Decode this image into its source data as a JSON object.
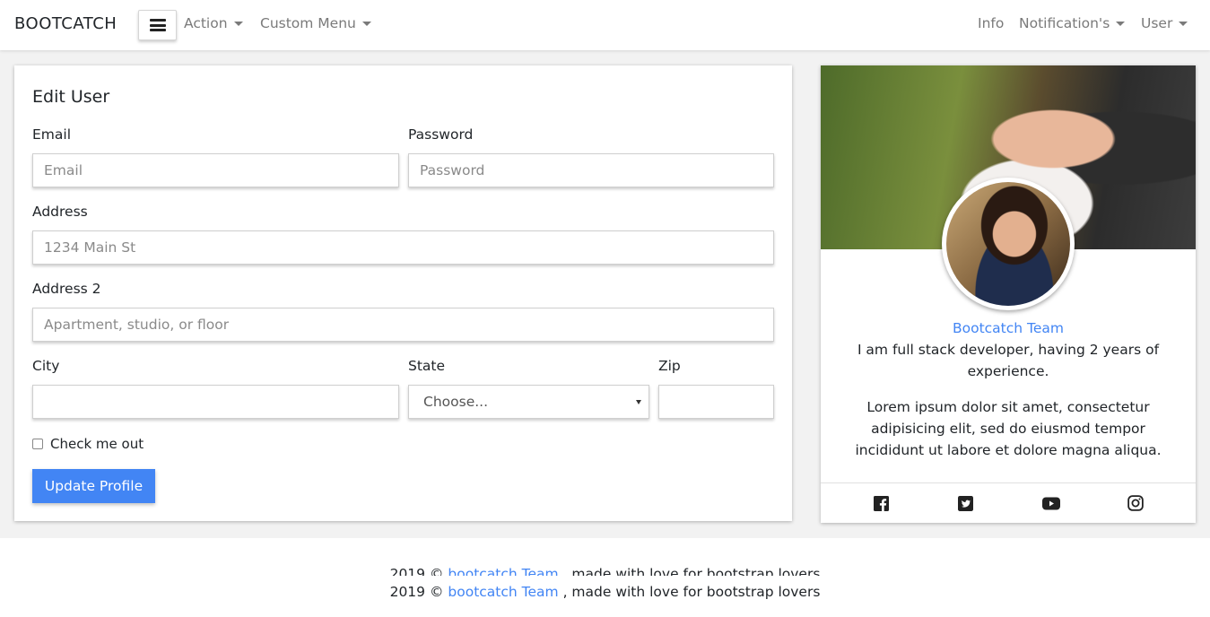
{
  "navbar": {
    "brand": "BOOTCATCH",
    "left_items": [
      {
        "label": "Action",
        "dropdown": true
      },
      {
        "label": "Custom Menu",
        "dropdown": true
      }
    ],
    "right_items": [
      {
        "label": "Info",
        "dropdown": false
      },
      {
        "label": "Notification's",
        "dropdown": true
      },
      {
        "label": "User",
        "dropdown": true
      }
    ]
  },
  "edit_form": {
    "title": "Edit User",
    "email": {
      "label": "Email",
      "placeholder": "Email",
      "value": ""
    },
    "password": {
      "label": "Password",
      "placeholder": "Password",
      "value": ""
    },
    "address": {
      "label": "Address",
      "placeholder": "1234 Main St",
      "value": ""
    },
    "address2": {
      "label": "Address 2",
      "placeholder": "Apartment, studio, or floor",
      "value": ""
    },
    "city": {
      "label": "City",
      "placeholder": "",
      "value": ""
    },
    "state": {
      "label": "State",
      "selected": "Choose..."
    },
    "zip": {
      "label": "Zip",
      "placeholder": "",
      "value": ""
    },
    "checkbox": {
      "label": "Check me out",
      "checked": false
    },
    "submit_label": "Update Profile"
  },
  "profile": {
    "name": "Bootcatch Team",
    "bio": "I am full stack developer, having 2 years of experience.",
    "description": "Lorem ipsum dolor sit amet, consectetur adipisicing elit, sed do eiusmod tempor incididunt ut labore et dolore magna aliqua.",
    "social_icons": [
      "facebook-icon",
      "twitter-icon",
      "youtube-icon",
      "instagram-icon"
    ]
  },
  "footer": {
    "year": "2019 ©",
    "team_link": "bootcatch Team",
    "suffix": ", made with love for bootstrap lovers"
  },
  "colors": {
    "accent": "#4285f4",
    "text": "#212529",
    "muted": "#7a7a7a",
    "background": "#f2f2f2"
  }
}
